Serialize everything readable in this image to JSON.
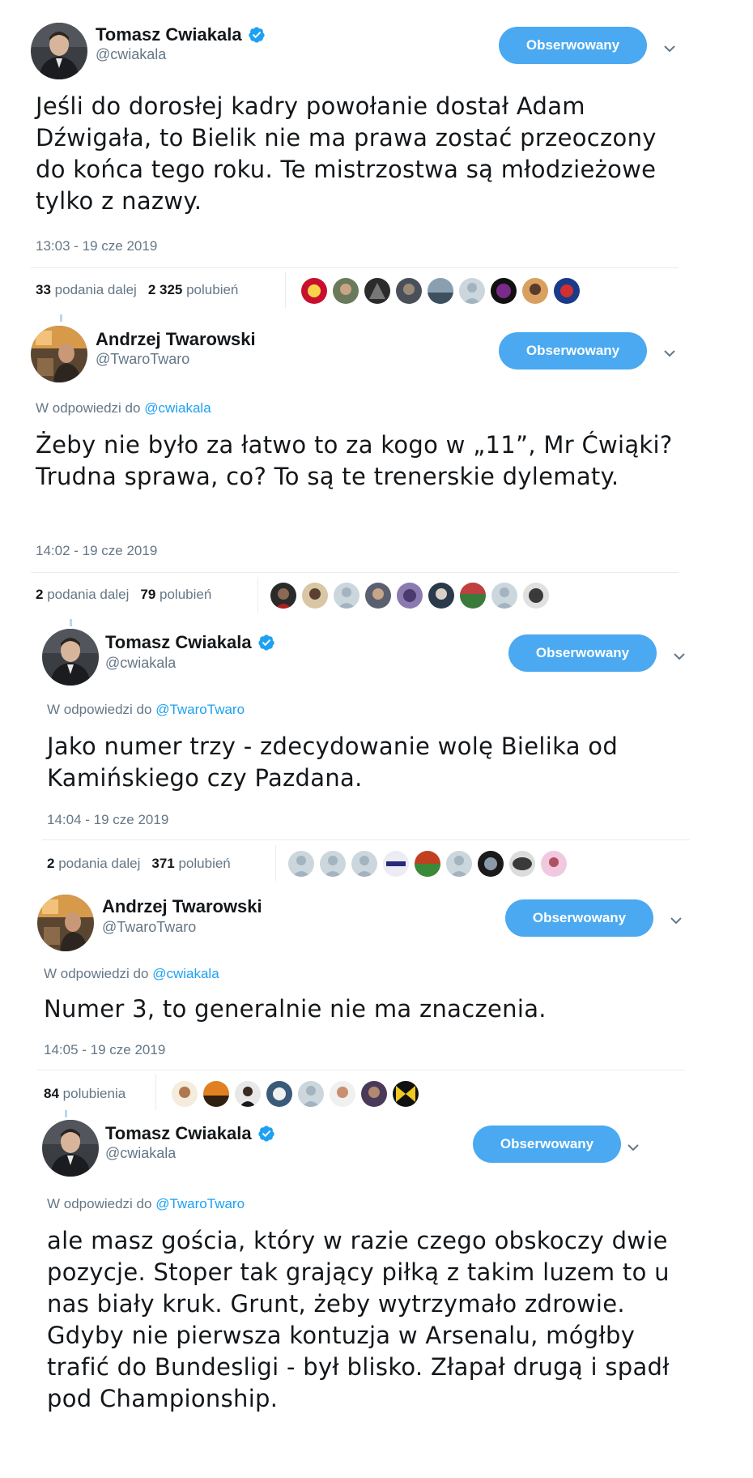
{
  "follow_label": "Obserwowany",
  "reply_prefix": "W odpowiedzi do",
  "tweets": [
    {
      "name": "Tomasz Cwiakala",
      "handle": "@cwiakala",
      "verified": true,
      "text": "Jeśli do dorosłej kadry powołanie dostał Adam Dźwigała, to Bielik nie ma prawa zostać przeoczony do końca tego roku. Te mistrzostwa są młodzieżowe tylko z nazwy.",
      "time": "13:03 - 19 cze 2019",
      "retweets_count": "33",
      "retweets_label": "podania dalej",
      "likes_count": "2 325",
      "likes_label": "polubień"
    },
    {
      "name": "Andrzej Twarowski",
      "handle": "@TwaroTwaro",
      "verified": false,
      "reply_to": "@cwiakala",
      "text": "Żeby nie było za łatwo to za kogo w „11”, Mr Ćwiąki? Trudna sprawa, co? To są te trenerskie dylematy.",
      "time": "14:02 - 19 cze 2019",
      "retweets_count": "2",
      "retweets_label": "podania dalej",
      "likes_count": "79",
      "likes_label": "polubień"
    },
    {
      "name": "Tomasz Cwiakala",
      "handle": "@cwiakala",
      "verified": true,
      "reply_to": "@TwaroTwaro",
      "text": "Jako numer trzy - zdecydowanie wolę Bielika od Kamińskiego czy Pazdana.",
      "time": "14:04 - 19 cze 2019",
      "retweets_count": "2",
      "retweets_label": "podania dalej",
      "likes_count": "371",
      "likes_label": "polubień"
    },
    {
      "name": "Andrzej Twarowski",
      "handle": "@TwaroTwaro",
      "verified": false,
      "reply_to": "@cwiakala",
      "text": "Numer 3, to generalnie nie ma znaczenia.",
      "time": "14:05 - 19 cze 2019",
      "likes_count": "84",
      "likes_label": "polubienia"
    },
    {
      "name": "Tomasz Cwiakala",
      "handle": "@cwiakala",
      "verified": true,
      "reply_to": "@TwaroTwaro",
      "text": "ale masz gościa, który w razie czego obskoczy dwie pozycje. Stoper tak grający piłką z takim luzem to u nas biały kruk. Grunt, żeby wytrzymało zdrowie. Gdyby nie pierwsza kontuzja w Arsenalu, mógłby trafić do Bundesligi - był blisko. Złapał drugą i spadł pod Championship."
    }
  ],
  "colors": {
    "accent": "#4aa9f0",
    "link": "#1da1f2",
    "muted": "#657786",
    "text": "#14171a",
    "divider": "#e6ecf0"
  },
  "icons": {
    "verified": "verified-badge-icon",
    "chevron": "chevron-down-icon"
  }
}
